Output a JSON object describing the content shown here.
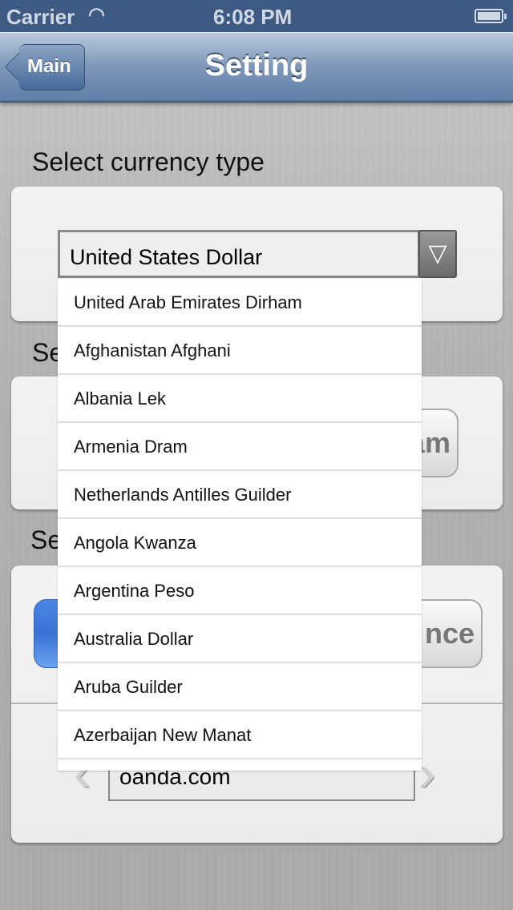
{
  "status_bar": {
    "carrier": "Carrier",
    "time": "6:08 PM",
    "wifi_icon": "wifi-icon",
    "battery_icon": "battery-icon"
  },
  "nav": {
    "back_label": "Main",
    "title": "Setting"
  },
  "sections": [
    {
      "label": "Select currency type",
      "selected_value": "United States Dollar"
    },
    {
      "label": "Se",
      "button_partial": "am"
    },
    {
      "label": "Se",
      "button_partial": "nce"
    }
  ],
  "source_field": {
    "value": "oanda.com"
  },
  "dropdown": {
    "options": [
      "United Arab Emirates Dirham",
      "Afghanistan Afghani",
      "Albania Lek",
      "Armenia Dram",
      "Netherlands Antilles Guilder",
      "Angola Kwanza",
      "Argentina Peso",
      "Australia Dollar",
      "Aruba Guilder",
      "Azerbaijan New Manat"
    ]
  },
  "colors": {
    "nav": "#5f7ea6",
    "status": "#3e5a82",
    "accent_blue": "#3a72d4"
  }
}
